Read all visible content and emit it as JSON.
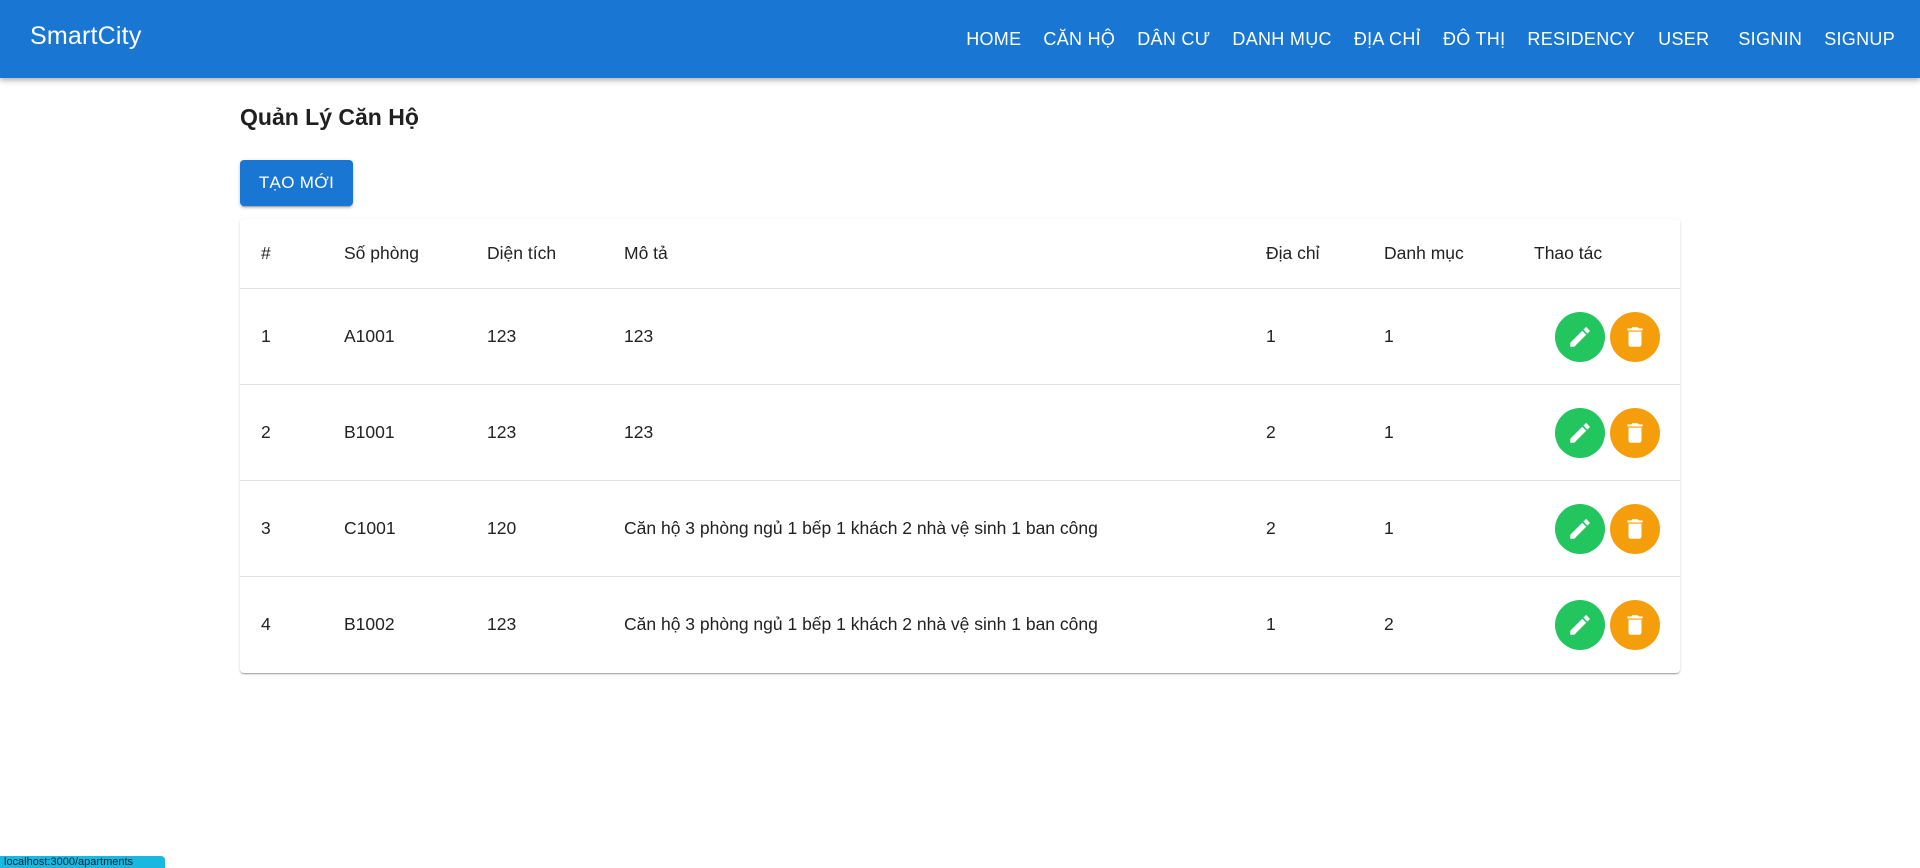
{
  "app": {
    "brand": "SmartCity",
    "nav": [
      {
        "label": "HOME"
      },
      {
        "label": "CĂN HỘ"
      },
      {
        "label": "DÂN CƯ"
      },
      {
        "label": "DANH MỤC"
      },
      {
        "label": "ĐỊA CHỈ"
      },
      {
        "label": "ĐÔ THỊ"
      },
      {
        "label": "RESIDENCY"
      },
      {
        "label": "USER"
      },
      {
        "label": "SIGNIN"
      },
      {
        "label": "SIGNUP"
      }
    ],
    "colors": {
      "primary": "#1976d2",
      "edit": "#22c55e",
      "delete": "#f59e0b"
    }
  },
  "page": {
    "title": "Quản Lý Căn Hộ",
    "create_label": "TẠO MỚI"
  },
  "table": {
    "headers": [
      "#",
      "Số phòng",
      "Diện tích",
      "Mô tả",
      "Địa chỉ",
      "Danh mục",
      "Thao tác"
    ],
    "rows": [
      {
        "idx": "1",
        "room": "A1001",
        "area": "123",
        "desc": "123",
        "address": "1",
        "category": "1"
      },
      {
        "idx": "2",
        "room": "B1001",
        "area": "123",
        "desc": "123",
        "address": "2",
        "category": "1"
      },
      {
        "idx": "3",
        "room": "C1001",
        "area": "120",
        "desc": "Căn hộ 3 phòng ngủ 1 bếp 1 khách 2 nhà vệ sinh 1 ban công",
        "address": "2",
        "category": "1"
      },
      {
        "idx": "4",
        "room": "B1002",
        "area": "123",
        "desc": "Căn hộ 3 phòng ngủ 1 bếp 1 khách 2 nhà vệ sinh 1 ban công",
        "address": "1",
        "category": "2"
      }
    ],
    "actions": {
      "edit_icon": "pencil-icon",
      "delete_icon": "trash-icon"
    }
  },
  "footer": {
    "badge_text": "localhost:3000/apartments"
  }
}
